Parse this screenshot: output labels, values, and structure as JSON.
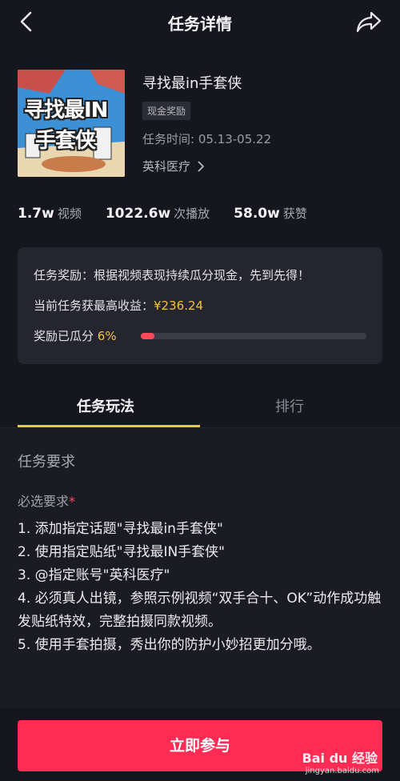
{
  "header": {
    "title": "任务详情"
  },
  "task": {
    "thumbnail_line1": "寻找最IN",
    "thumbnail_line2": "手套侠",
    "name": "寻找最in手套侠",
    "badge": "现金奖励",
    "time": "任务时间: 05.13-05.22",
    "sponsor": "英科医疗"
  },
  "stats": [
    {
      "value": "1.7w",
      "label": "视频"
    },
    {
      "value": "1022.6w",
      "label": "次播放"
    },
    {
      "value": "58.0w",
      "label": "获赞"
    }
  ],
  "reward": {
    "description": "任务奖励：根据视频表现持续瓜分现金，先到先得！",
    "max_income_label": "当前任务获最高收益：",
    "max_income_value": "¥236.24",
    "split_label": "奖励已瓜分",
    "split_percent_text": "6%",
    "split_fraction": 0.06
  },
  "tabs": {
    "active": "任务玩法",
    "rank": "排行"
  },
  "requirements": {
    "section_title": "任务要求",
    "required_label": "必选要求",
    "required_star": "*",
    "items": [
      "1. 添加指定话题\"寻找最in手套侠\"",
      "2. 使用指定贴纸\"寻找最IN手套侠\"",
      "3. @指定账号\"英科医疗\"",
      "4. 必须真人出镜，参照示例视频“双手合十、OK”动作成功触发贴纸特效，完整拍摄同款视频。",
      "5. 使用手套拍摄，秀出你的防护小妙招更加分哦。"
    ]
  },
  "cta": {
    "join_label": "立即参与"
  },
  "watermark": {
    "brand": "Bai du 经验",
    "url": "jingyan.baidu.com"
  },
  "colors": {
    "accent_red": "#fe2c55",
    "gold": "#f5c23e",
    "background": "#16161f"
  }
}
